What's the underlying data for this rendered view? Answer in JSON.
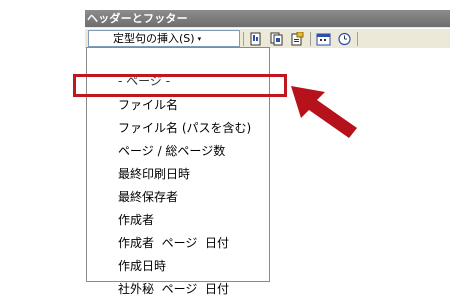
{
  "toolbar": {
    "title": "ヘッダーとフッター",
    "insert_autotext_label": "定型句の挿入(S)",
    "insert_autotext_arrow": "▾"
  },
  "menu": {
    "header": "- ページ -",
    "items": [
      "ファイル名",
      "ファイル名 (パスを含む)",
      "ページ / 総ページ数",
      "最終印刷日時",
      "最終保存者",
      "作成者",
      "作成者  ページ  日付",
      "作成日時",
      "社外秘  ページ  日付"
    ],
    "highlighted_item": "ファイル名"
  },
  "colors": {
    "highlight": "#c0161e",
    "arrow": "#b5121b",
    "titlebar": "#7a7a7a"
  },
  "icons": [
    "insert-page-number-icon",
    "insert-page-count-icon",
    "format-page-number-icon",
    "insert-date-icon",
    "insert-time-icon"
  ]
}
